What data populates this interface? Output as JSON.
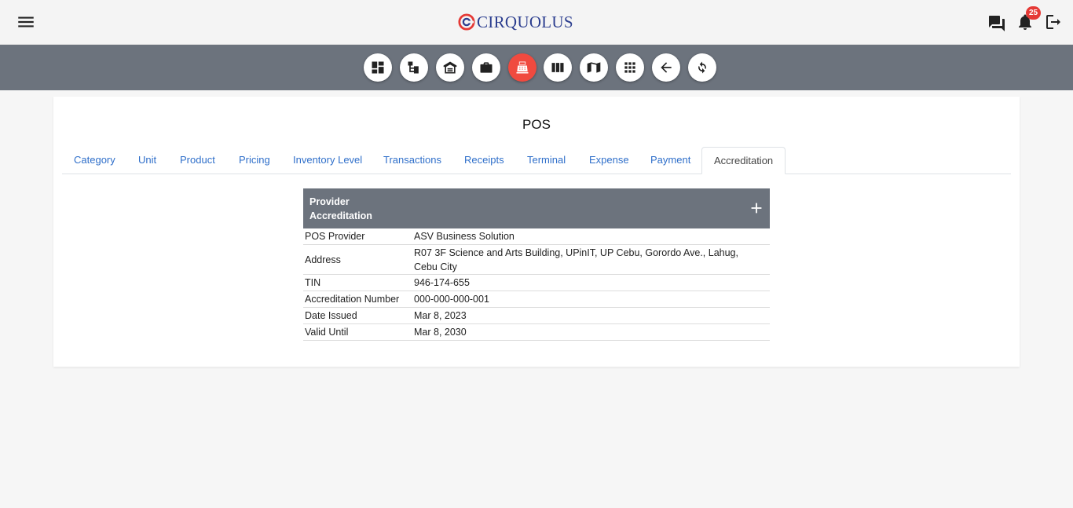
{
  "brand": {
    "name": "CIRQUOLUS",
    "accent": "#e53935",
    "primary": "#2c3e8f"
  },
  "header": {
    "menu_icon": "hamburger-icon",
    "right_icons": [
      "chat-icon",
      "bell-icon",
      "logout-icon"
    ],
    "notification_count": "25"
  },
  "toolbar": {
    "buttons": [
      {
        "icon": "dashboard-icon"
      },
      {
        "icon": "org-tree-icon"
      },
      {
        "icon": "warehouse-icon"
      },
      {
        "icon": "briefcase-icon"
      },
      {
        "icon": "cash-register-icon",
        "active": true
      },
      {
        "icon": "columns-icon"
      },
      {
        "icon": "map-book-icon"
      },
      {
        "icon": "apps-grid-icon"
      },
      {
        "icon": "back-arrow-icon"
      },
      {
        "icon": "refresh-icon"
      }
    ],
    "active_color": "#f04a3f"
  },
  "page": {
    "title": "POS"
  },
  "tabs": [
    "Category",
    "Unit",
    "Product",
    "Pricing",
    "Inventory Level",
    "Transactions",
    "Receipts",
    "Terminal",
    "Expense",
    "Payment",
    "Accreditation"
  ],
  "active_tab": "Accreditation",
  "accreditation": {
    "title": "Provider Accreditation",
    "add_icon": "plus-icon",
    "rows": [
      {
        "label": "POS Provider",
        "value": "ASV Business Solution"
      },
      {
        "label": "Address",
        "value": "R07 3F Science and Arts Building, UPinIT, UP Cebu, Gorordo Ave., Lahug, Cebu City"
      },
      {
        "label": "TIN",
        "value": "946-174-655"
      },
      {
        "label": "Accreditation Number",
        "value": "000-000-000-001"
      },
      {
        "label": "Date Issued",
        "value": "Mar 8, 2023"
      },
      {
        "label": "Valid Until",
        "value": "Mar 8, 2030"
      }
    ]
  }
}
